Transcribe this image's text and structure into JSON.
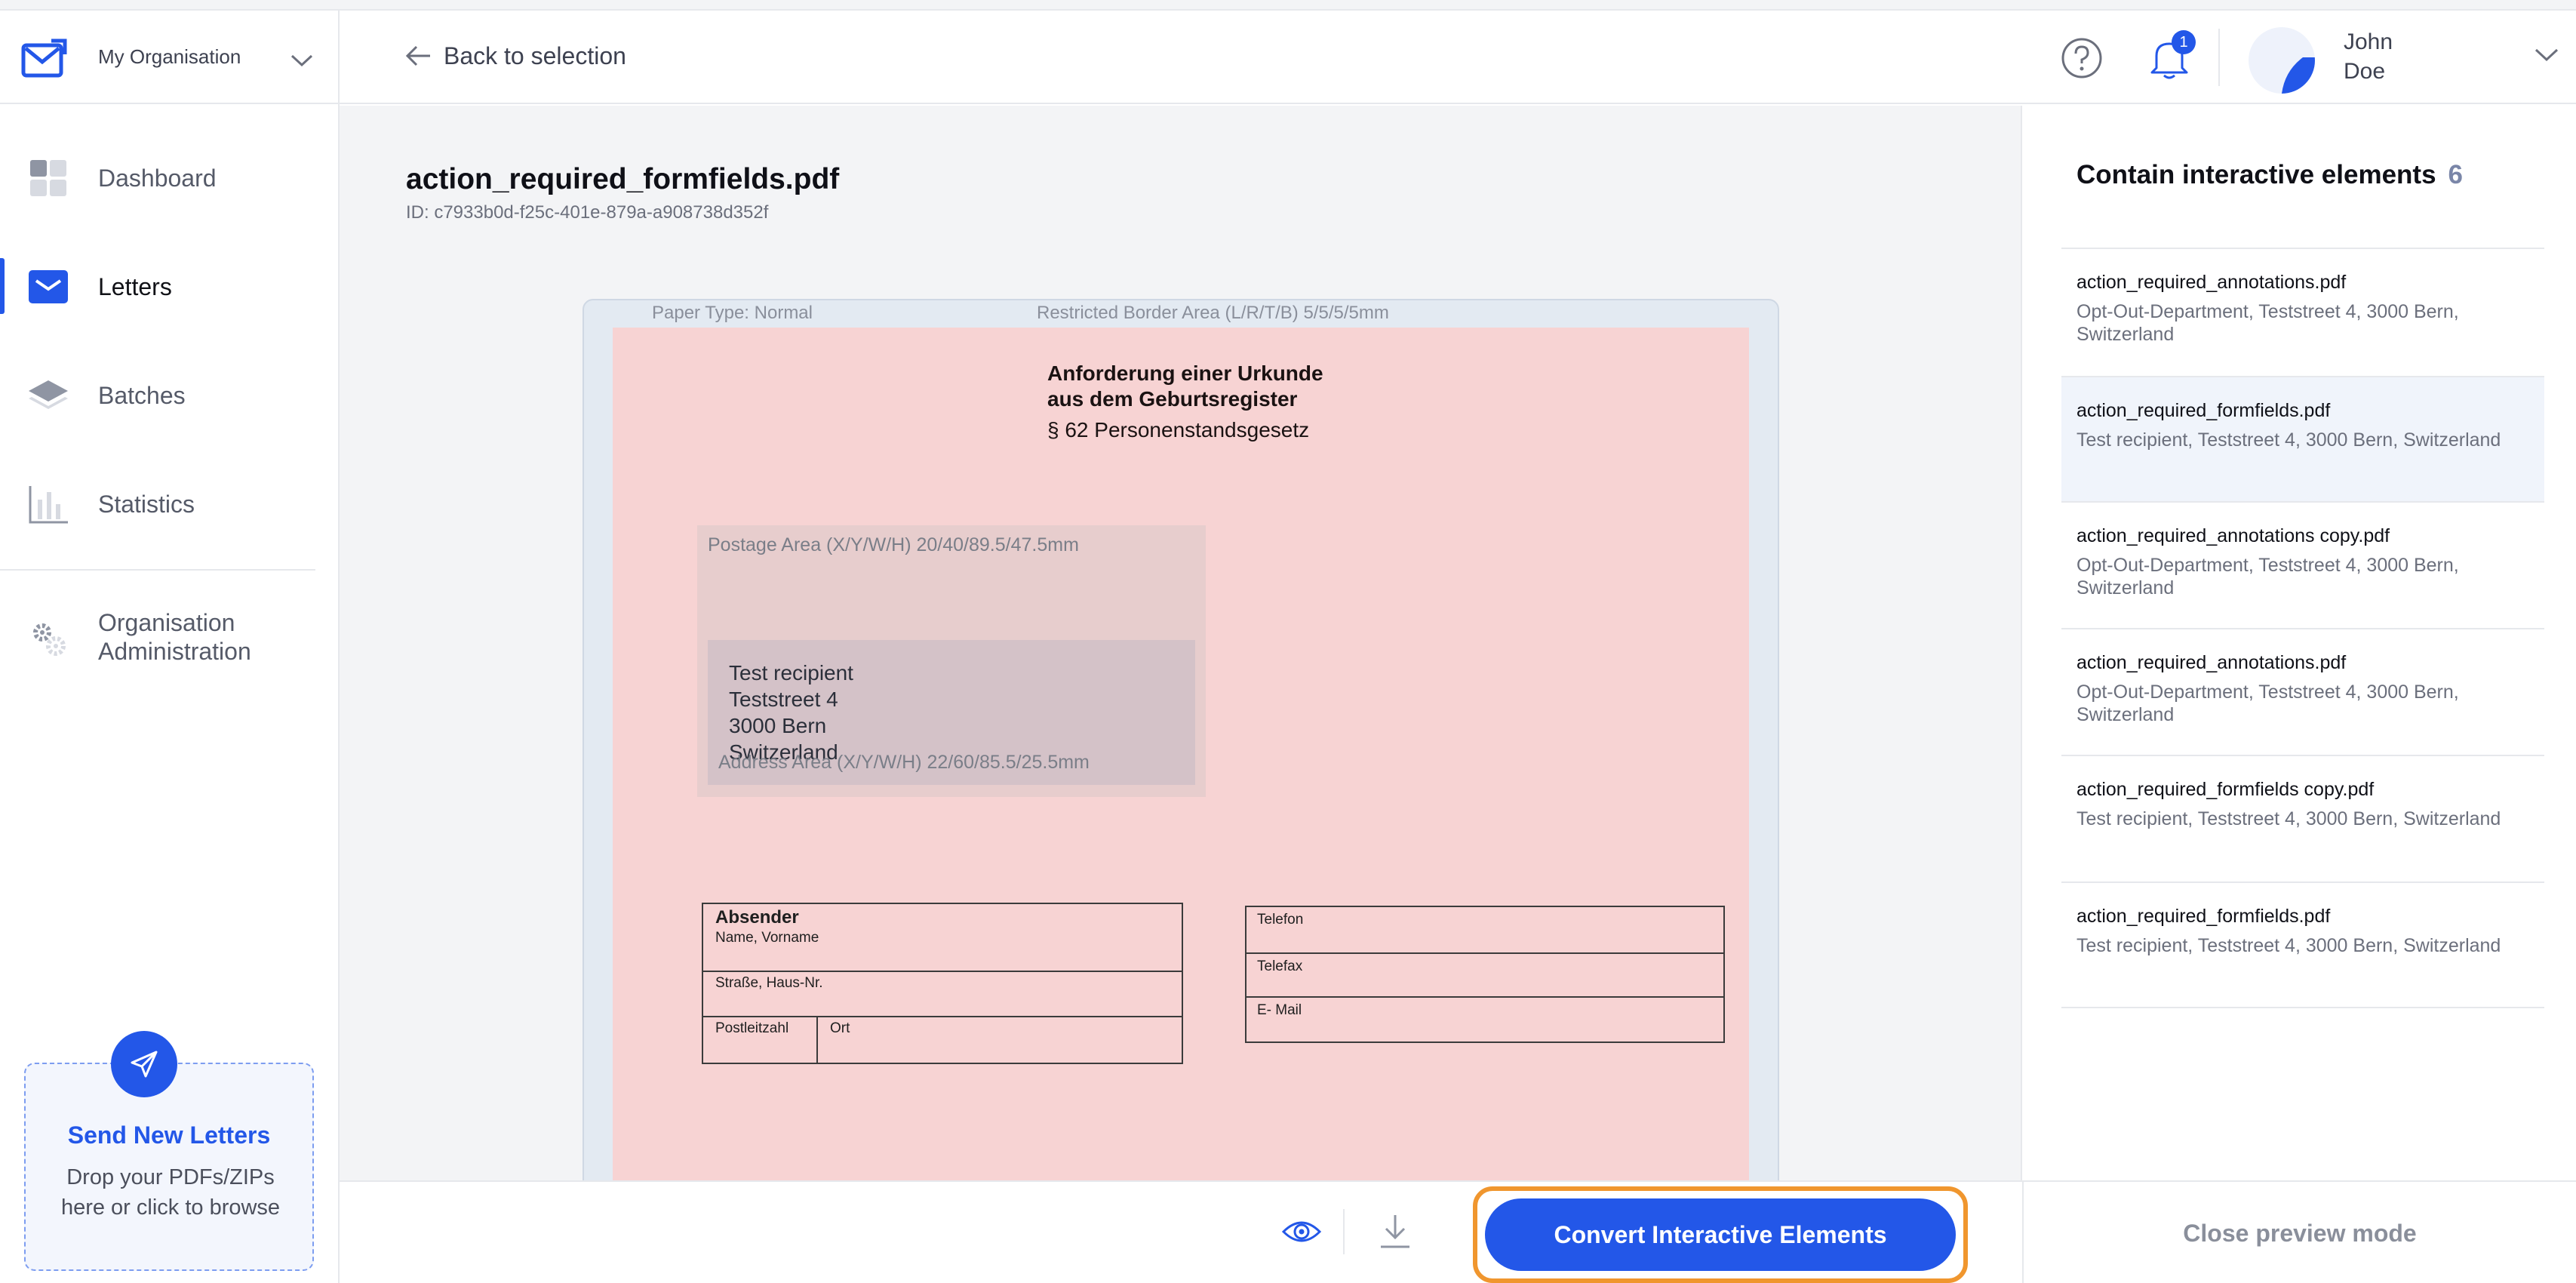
{
  "sidebar": {
    "org_name": "My Organisation",
    "nav": [
      {
        "label": "Dashboard"
      },
      {
        "label": "Letters"
      },
      {
        "label": "Batches"
      },
      {
        "label": "Statistics"
      }
    ],
    "admin_line1": "Organisation",
    "admin_line2": "Administration",
    "dropzone": {
      "title": "Send New Letters",
      "text": "Drop your PDFs/ZIPs here or click to browse"
    }
  },
  "header": {
    "back_label": "Back to selection",
    "notification_count": "1",
    "user_first": "John",
    "user_last": "Doe"
  },
  "preview": {
    "file_name": "action_required_formfields.pdf",
    "file_id": "ID: c7933b0d-f25c-401e-879a-a908738d352f",
    "paper_type": "Paper Type: Normal",
    "border_area": "Restricted Border Area (L/R/T/B) 5/5/5/5mm",
    "doc_heading_1": "Anforderung einer Urkunde",
    "doc_heading_2": "aus dem Geburtsregister",
    "doc_subheading": "§ 62 Personenstandsgesetz",
    "postage_label": "Postage Area (X/Y/W/H) 20/40/89.5/47.5mm",
    "address_label": "Address Area (X/Y/W/H) 22/60/85.5/25.5mm",
    "address": {
      "line1": "Test recipient",
      "line2": "Teststreet 4",
      "line3": "3000 Bern",
      "line4": "Switzerland"
    },
    "form": {
      "absender": "Absender",
      "name": "Name, Vorname",
      "strasse": "Straße, Haus-Nr.",
      "plz": "Postleitzahl",
      "ort": "Ort",
      "telefon": "Telefon",
      "telefax": "Telefax",
      "email": "E- Mail"
    }
  },
  "bottom": {
    "convert_label": "Convert Interactive Elements",
    "close_label": "Close preview mode"
  },
  "right_panel": {
    "title": "Contain interactive elements",
    "count": "6",
    "items": [
      {
        "file": "action_required_annotations.pdf",
        "address": "Opt-Out-Department, Teststreet 4, 3000 Bern, Switzerland"
      },
      {
        "file": "action_required_formfields.pdf",
        "address": "Test recipient, Teststreet 4, 3000 Bern, Switzerland"
      },
      {
        "file": "action_required_annotations copy.pdf",
        "address": "Opt-Out-Department, Teststreet 4, 3000 Bern, Switzerland"
      },
      {
        "file": "action_required_annotations.pdf",
        "address": "Opt-Out-Department, Teststreet 4, 3000 Bern, Switzerland"
      },
      {
        "file": "action_required_formfields copy.pdf",
        "address": "Test recipient, Teststreet 4, 3000 Bern, Switzerland"
      },
      {
        "file": "action_required_formfields.pdf",
        "address": "Test recipient, Teststreet 4, 3000 Bern, Switzerland"
      }
    ]
  },
  "colors": {
    "accent": "#2357e8",
    "highlight_border": "#f0962e",
    "paper_pink": "#f7d3d3"
  }
}
